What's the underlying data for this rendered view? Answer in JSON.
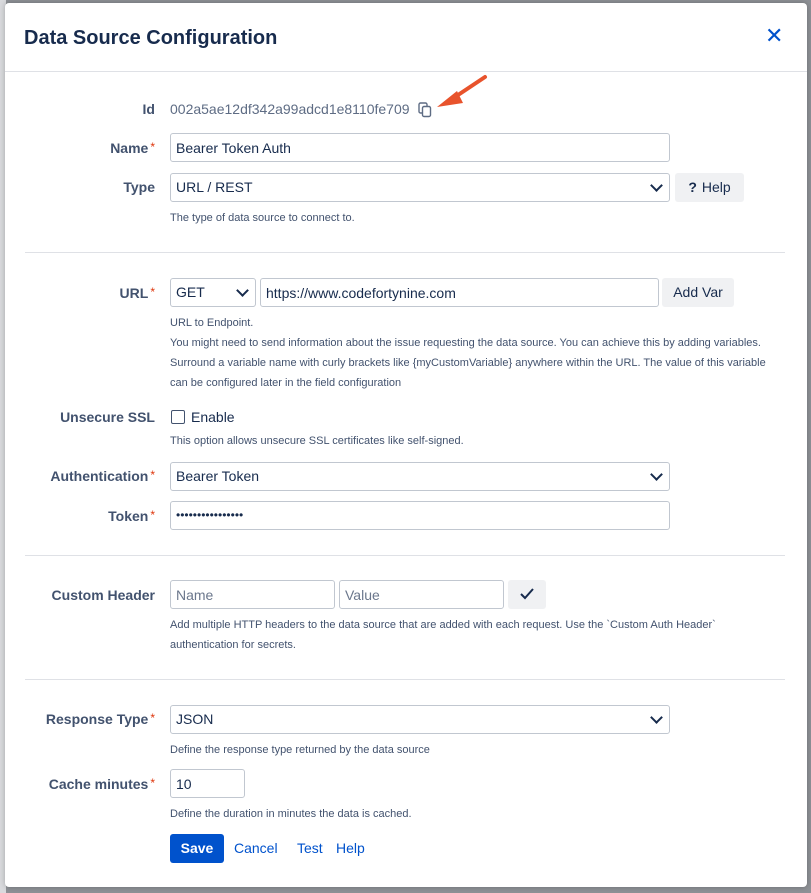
{
  "dialog": {
    "title": "Data Source Configuration",
    "close_icon": "close-icon"
  },
  "id_field": {
    "label": "Id",
    "value": "002a5ae12df342a99adcd1e8110fe709",
    "copy_icon": "copy-icon"
  },
  "name_field": {
    "label": "Name",
    "value": "Bearer Token Auth"
  },
  "type_field": {
    "label": "Type",
    "value": "URL / REST",
    "help_button": "Help",
    "help_icon": "?",
    "description": "The type of data source to connect to."
  },
  "url_field": {
    "label": "URL",
    "method": "GET",
    "value": "https://www.codefortynine.com",
    "add_var_button": "Add Var",
    "description_lines": [
      "URL to Endpoint.",
      "You might need to send information about the issue requesting the data source. You can achieve this by adding variables.",
      "Surround a variable name with curly brackets like {myCustomVariable} anywhere within the URL. The value of this variable",
      "can be configured later in the field configuration"
    ]
  },
  "ssl_field": {
    "label": "Unsecure SSL",
    "checkbox_label": "Enable",
    "checked": false,
    "description": "This option allows unsecure SSL certificates like self-signed."
  },
  "auth_field": {
    "label": "Authentication",
    "value": "Bearer Token"
  },
  "token_field": {
    "label": "Token",
    "value": "••••••••••••••••"
  },
  "header_field": {
    "label": "Custom Header",
    "name_placeholder": "Name",
    "value_placeholder": "Value",
    "confirm_icon": "check-icon",
    "description_lines": [
      "Add multiple HTTP headers to the data source that are added with each request. Use the `Custom Auth Header`",
      "authentication for secrets."
    ]
  },
  "response_field": {
    "label": "Response Type",
    "value": "JSON",
    "description": "Define the response type returned by the data source"
  },
  "cache_field": {
    "label": "Cache minutes",
    "value": "10",
    "description": "Define the duration in minutes the data is cached."
  },
  "actions": {
    "save": "Save",
    "cancel": "Cancel",
    "test": "Test",
    "help": "Help"
  },
  "colors": {
    "primary": "#0052cc",
    "required": "#de350b",
    "annotation_arrow": "#e8532c"
  }
}
